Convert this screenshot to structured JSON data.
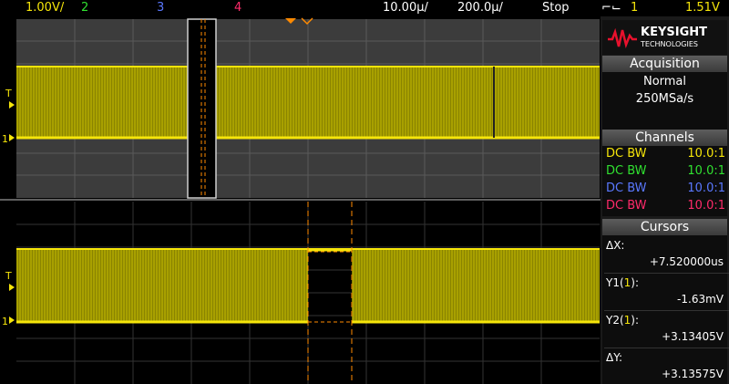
{
  "topbar": {
    "ch1_scale": "1.00V/",
    "ch2": "2",
    "ch3": "3",
    "ch4": "4",
    "time_scale": "10.00µ/",
    "delay": "200.0µ/",
    "run_state": "Stop",
    "trigger_source": "1",
    "trigger_level": "1.51V"
  },
  "brand": {
    "name": "KEYSIGHT",
    "sub": "TECHNOLOGIES"
  },
  "acquisition": {
    "title": "Acquisition",
    "mode": "Normal",
    "rate": "250MSa/s"
  },
  "channels": {
    "title": "Channels",
    "rows": [
      {
        "coupling": "DC BW",
        "probe": "10.0:1",
        "color": "#f5e50a"
      },
      {
        "coupling": "DC BW",
        "probe": "10.0:1",
        "color": "#30e030"
      },
      {
        "coupling": "DC BW",
        "probe": "10.0:1",
        "color": "#5a78ff"
      },
      {
        "coupling": "DC BW",
        "probe": "10.0:1",
        "color": "#ff2a6a"
      }
    ]
  },
  "cursors": {
    "title": "Cursors",
    "dx_label": "ΔX:",
    "dx_value": "+7.520000us",
    "y1_label": "Y1(1):",
    "y1_value": "-1.63mV",
    "y2_label": "Y2(1):",
    "y2_value": "+3.13405V",
    "dy_label": "ΔY:",
    "dy_value": "+3.13575V"
  },
  "markers": {
    "trigger": "T",
    "ground": "1"
  },
  "colors": {
    "ch1": "#f5e50a",
    "ch2": "#30e030",
    "ch3": "#5a78ff",
    "ch4": "#ff2a6a",
    "cursor": "#ff8a00",
    "panel_header": "#4a4a4a"
  }
}
